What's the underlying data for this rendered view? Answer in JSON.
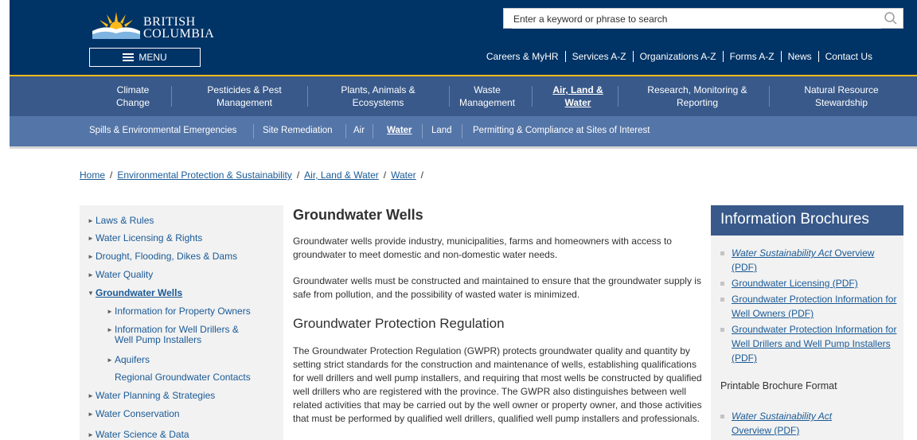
{
  "header": {
    "logo_line1": "BRITISH",
    "logo_line2": "COLUMBIA",
    "search_placeholder": "Enter a keyword or phrase to search",
    "menu_label": "MENU",
    "utility_links": [
      "Careers & MyHR",
      "Services A-Z",
      "Organizations A-Z",
      "Forms A-Z",
      "News",
      "Contact Us"
    ]
  },
  "topnav": [
    {
      "line1": "Climate",
      "line2": "Change"
    },
    {
      "line1": "Pesticides & Pest",
      "line2": "Management"
    },
    {
      "line1": "Plants, Animals &",
      "line2": "Ecosystems"
    },
    {
      "line1": "Waste",
      "line2": "Management"
    },
    {
      "line1": "Air, Land &",
      "line2": "Water"
    },
    {
      "line1": "Research, Monitoring &",
      "line2": "Reporting"
    },
    {
      "line1": "Natural Resource",
      "line2": "Stewardship"
    }
  ],
  "subnav": [
    "Spills & Environmental Emergencies",
    "Site Remediation",
    "Air",
    "Water",
    "Land",
    "Permitting & Compliance at Sites of Interest"
  ],
  "breadcrumb": [
    "Home",
    "Environmental Protection & Sustainability",
    "Air, Land & Water",
    "Water"
  ],
  "breadcrumb_sep": "/",
  "sidenav": [
    "Laws & Rules",
    "Water Licensing & Rights",
    "Drought, Flooding, Dikes & Dams",
    "Water Quality",
    "Groundwater Wells",
    "Information for Property Owners",
    "Information for Well Drillers &",
    "Well Pump Installers",
    "Aquifers",
    "Regional Groundwater Contacts",
    "Water Planning & Strategies",
    "Water Conservation",
    "Water Science & Data"
  ],
  "main": {
    "title": "Groundwater Wells",
    "p1": "Groundwater wells provide industry, municipalities, farms and homeowners with access to groundwater to meet domestic and non-domestic water needs.",
    "p2": "Groundwater wells must be constructed and maintained to ensure that the groundwater supply is safe from pollution, and the possibility of wasted water is minimized.",
    "subtitle": "Groundwater Protection Regulation",
    "p3": "The Groundwater Protection Regulation (GWPR) protects groundwater quality and quantity by setting strict standards for the construction and maintenance of wells, establishing qualifications for well drillers and well pump installers, and requiring that most wells be constructed by qualified well drillers who are registered with the province. The GWPR also distinguishes between well related activities that may be carried out by the well owner or property owner, and those activities that must be performed by qualified well drillers, qualified well pump installers and professionals."
  },
  "aside": {
    "title": "Information Brochures",
    "link1_italic": "Water Sustainability Act",
    "link1_rest": " Overview (PDF)",
    "link2": "Groundwater Licensing (PDF)",
    "link3": "Groundwater Protection Information for Well Owners (PDF)",
    "link4": "Groundwater Protection Information for Well Drillers and Well Pump Installers (PDF)",
    "printable": "Printable Brochure Format",
    "link5_italic": "Water Sustainability Act",
    "link5_rest": "Overview (PDF)"
  },
  "colors": {
    "header": "#003366",
    "gold": "#fcba19",
    "topnav": "#38598a",
    "subnav": "#5475a7",
    "link": "#1a5a96"
  }
}
